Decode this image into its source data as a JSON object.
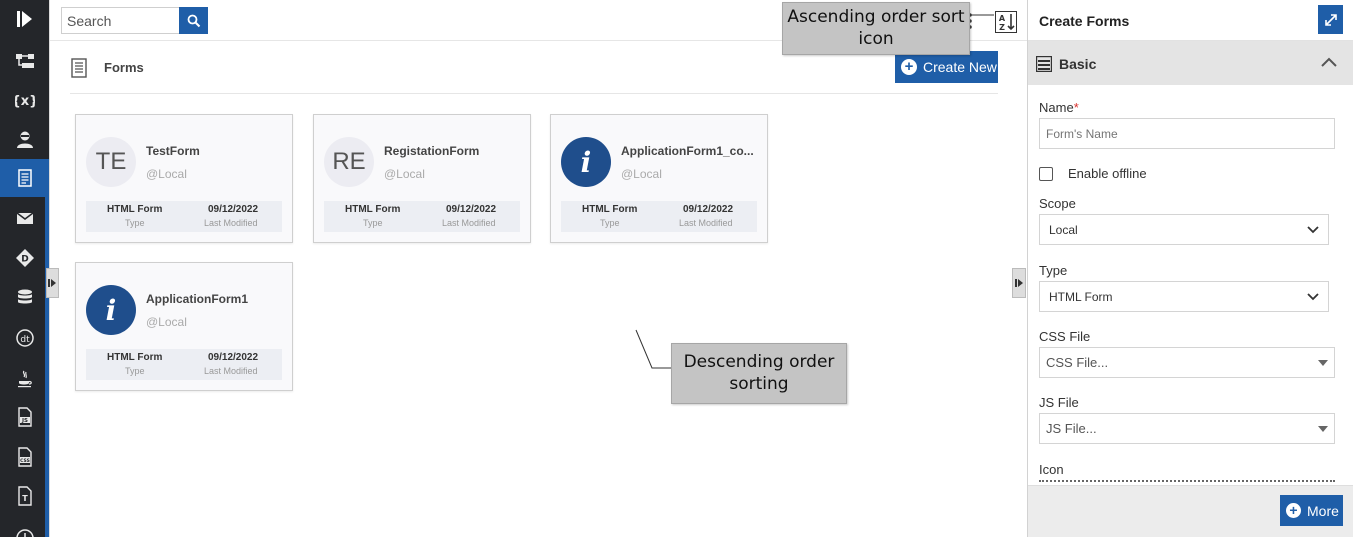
{
  "search": {
    "placeholder": "Search"
  },
  "header": {
    "title": "Forms",
    "create_label": "Create New"
  },
  "forms": [
    {
      "initials": "TE",
      "icon": "initials",
      "name": "TestForm",
      "scope": "@Local",
      "type_value": "HTML Form",
      "type_label": "Type",
      "date_value": "09/12/2022",
      "date_label": "Last Modified"
    },
    {
      "initials": "RE",
      "icon": "initials",
      "name": "RegistationForm",
      "scope": "@Local",
      "type_value": "HTML Form",
      "type_label": "Type",
      "date_value": "09/12/2022",
      "date_label": "Last Modified"
    },
    {
      "initials": "i",
      "icon": "info-icon",
      "name": "ApplicationForm1_co...",
      "scope": "@Local",
      "type_value": "HTML Form",
      "type_label": "Type",
      "date_value": "09/12/2022",
      "date_label": "Last Modified"
    },
    {
      "initials": "i",
      "icon": "info-icon",
      "name": "ApplicationForm1",
      "scope": "@Local",
      "type_value": "HTML Form",
      "type_label": "Type",
      "date_value": "09/12/2022",
      "date_label": "Last Modified"
    }
  ],
  "callouts": {
    "ascending": "Ascending order sort icon",
    "descending": "Descending order sorting"
  },
  "panel": {
    "title": "Create Forms",
    "section": "Basic",
    "name_label": "Name",
    "name_required": "*",
    "name_placeholder": "Form's Name",
    "offline_label": "Enable offline",
    "scope_label": "Scope",
    "scope_value": "Local",
    "type_label": "Type",
    "type_value": "HTML Form",
    "css_label": "CSS File",
    "css_placeholder": "CSS File...",
    "js_label": "JS File",
    "js_placeholder": "JS File...",
    "icon_label": "Icon",
    "more_label": "More"
  },
  "colors": {
    "accent": "#1f5ea8",
    "rail": "#24262a"
  },
  "rail_icons": [
    "logo-icon",
    "workflow-icon",
    "variables-icon",
    "user-icon",
    "forms-icon",
    "mail-icon",
    "plugin-icon",
    "database-icon",
    "datatable-icon",
    "java-icon",
    "js-file-icon",
    "css-file-icon",
    "text-file-icon",
    "history-icon"
  ]
}
